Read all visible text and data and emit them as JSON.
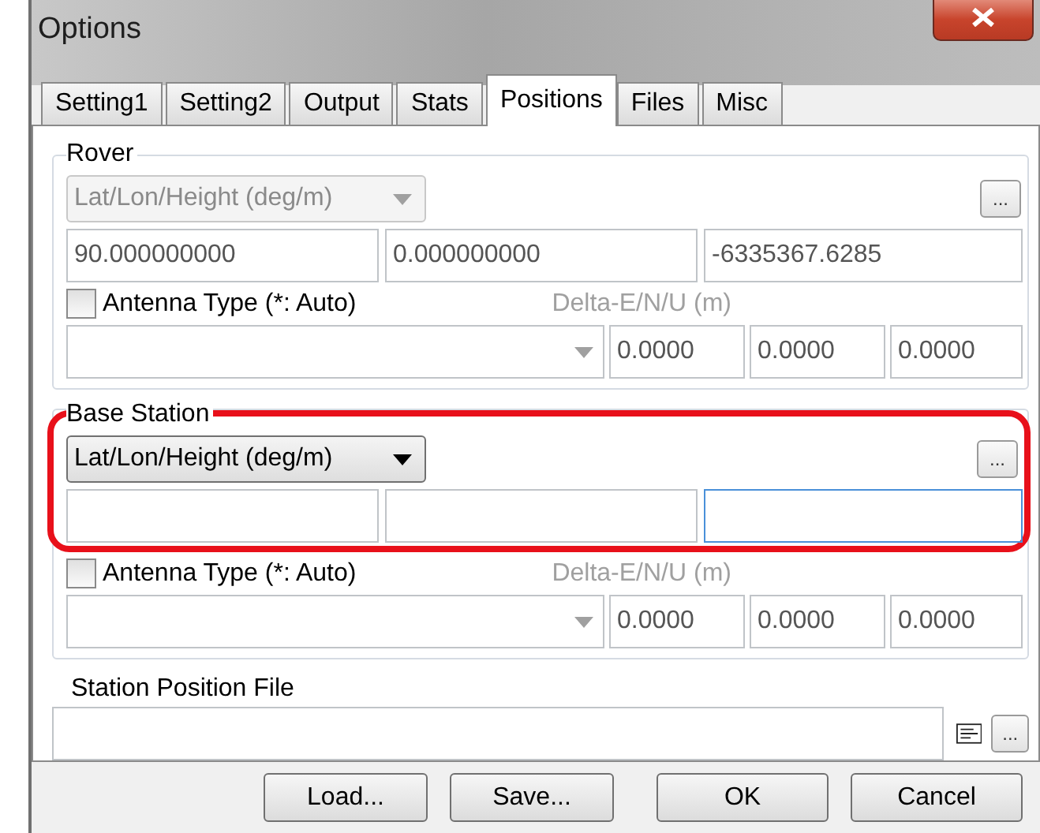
{
  "window": {
    "title": "Options"
  },
  "tabs": [
    {
      "label": "Setting1",
      "selected": false
    },
    {
      "label": "Setting2",
      "selected": false
    },
    {
      "label": "Output",
      "selected": false
    },
    {
      "label": "Stats",
      "selected": false
    },
    {
      "label": "Positions",
      "selected": true
    },
    {
      "label": "Files",
      "selected": false
    },
    {
      "label": "Misc",
      "selected": false
    }
  ],
  "rover": {
    "title": "Rover",
    "browse_button": "...",
    "format": {
      "value": "Lat/Lon/Height (deg/m)",
      "disabled": true
    },
    "coords": [
      {
        "value": "90.000000000",
        "focused": false
      },
      {
        "value": "0.000000000",
        "focused": false
      },
      {
        "value": "-6335367.6285",
        "focused": false
      }
    ],
    "antenna": {
      "label": "Antenna Type (*: Auto)",
      "checked": false
    },
    "delta_label": {
      "text": "Delta-E/N/U (m)",
      "disabled": true
    },
    "delta": [
      "0.0000",
      "0.0000",
      "0.0000"
    ]
  },
  "base_station": {
    "title": "Base Station",
    "browse_button": "...",
    "highlighted": true,
    "format": {
      "value": "Lat/Lon/Height (deg/m)",
      "disabled": false
    },
    "coords": [
      {
        "focused": false
      },
      {
        "focused": false
      },
      {
        "focused": true
      }
    ],
    "antenna": {
      "label": "Antenna Type (*: Auto)",
      "checked": false
    },
    "delta_label": {
      "text": "Delta-E/N/U (m)",
      "disabled": true
    },
    "delta": [
      "0.0000",
      "0.0000",
      "0.0000"
    ]
  },
  "station_position_file": {
    "label": "Station Position File",
    "browse_button": "..."
  },
  "buttons": [
    "Load...",
    "Save...",
    "OK",
    "Cancel"
  ]
}
